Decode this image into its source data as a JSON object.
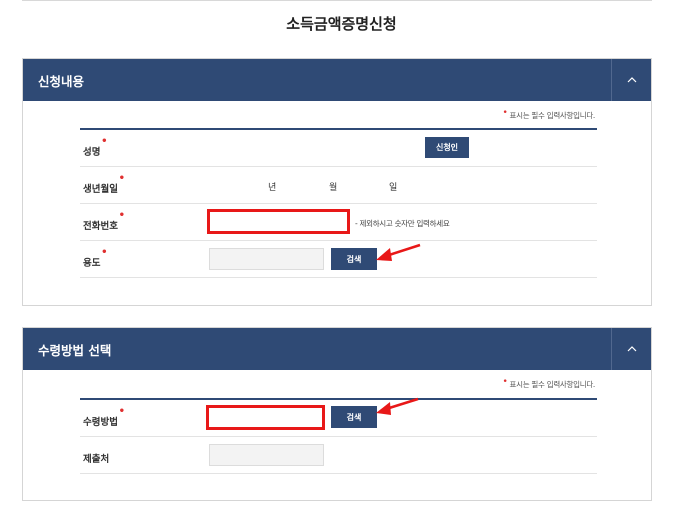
{
  "page_title": "소득금액증명신청",
  "colors": {
    "header": "#2f4a75",
    "highlight": "#e81818",
    "required": "#e03030"
  },
  "icons": {
    "collapse": "chevron-up-icon",
    "pointer": "red-arrow-icon"
  },
  "section1": {
    "title": "신청내용",
    "required_note": "표시는 필수 입력사항입니다.",
    "fields": {
      "name_label": "성명",
      "applicant_button": "신청인",
      "birth_label": "생년월일",
      "year": "년",
      "month": "월",
      "day": "일",
      "phone_label": "전화번호",
      "phone_value": "",
      "phone_hint": "- 제외하시고 숫자만 입력하세요",
      "usage_label": "용도",
      "usage_value": "",
      "search_button": "검색"
    }
  },
  "section2": {
    "title": "수령방법 선택",
    "required_note": "표시는 필수 입력사항입니다.",
    "fields": {
      "method_label": "수령방법",
      "method_value": "",
      "search_button": "검색",
      "submit_to_label": "제출처",
      "submit_to_value": ""
    }
  }
}
